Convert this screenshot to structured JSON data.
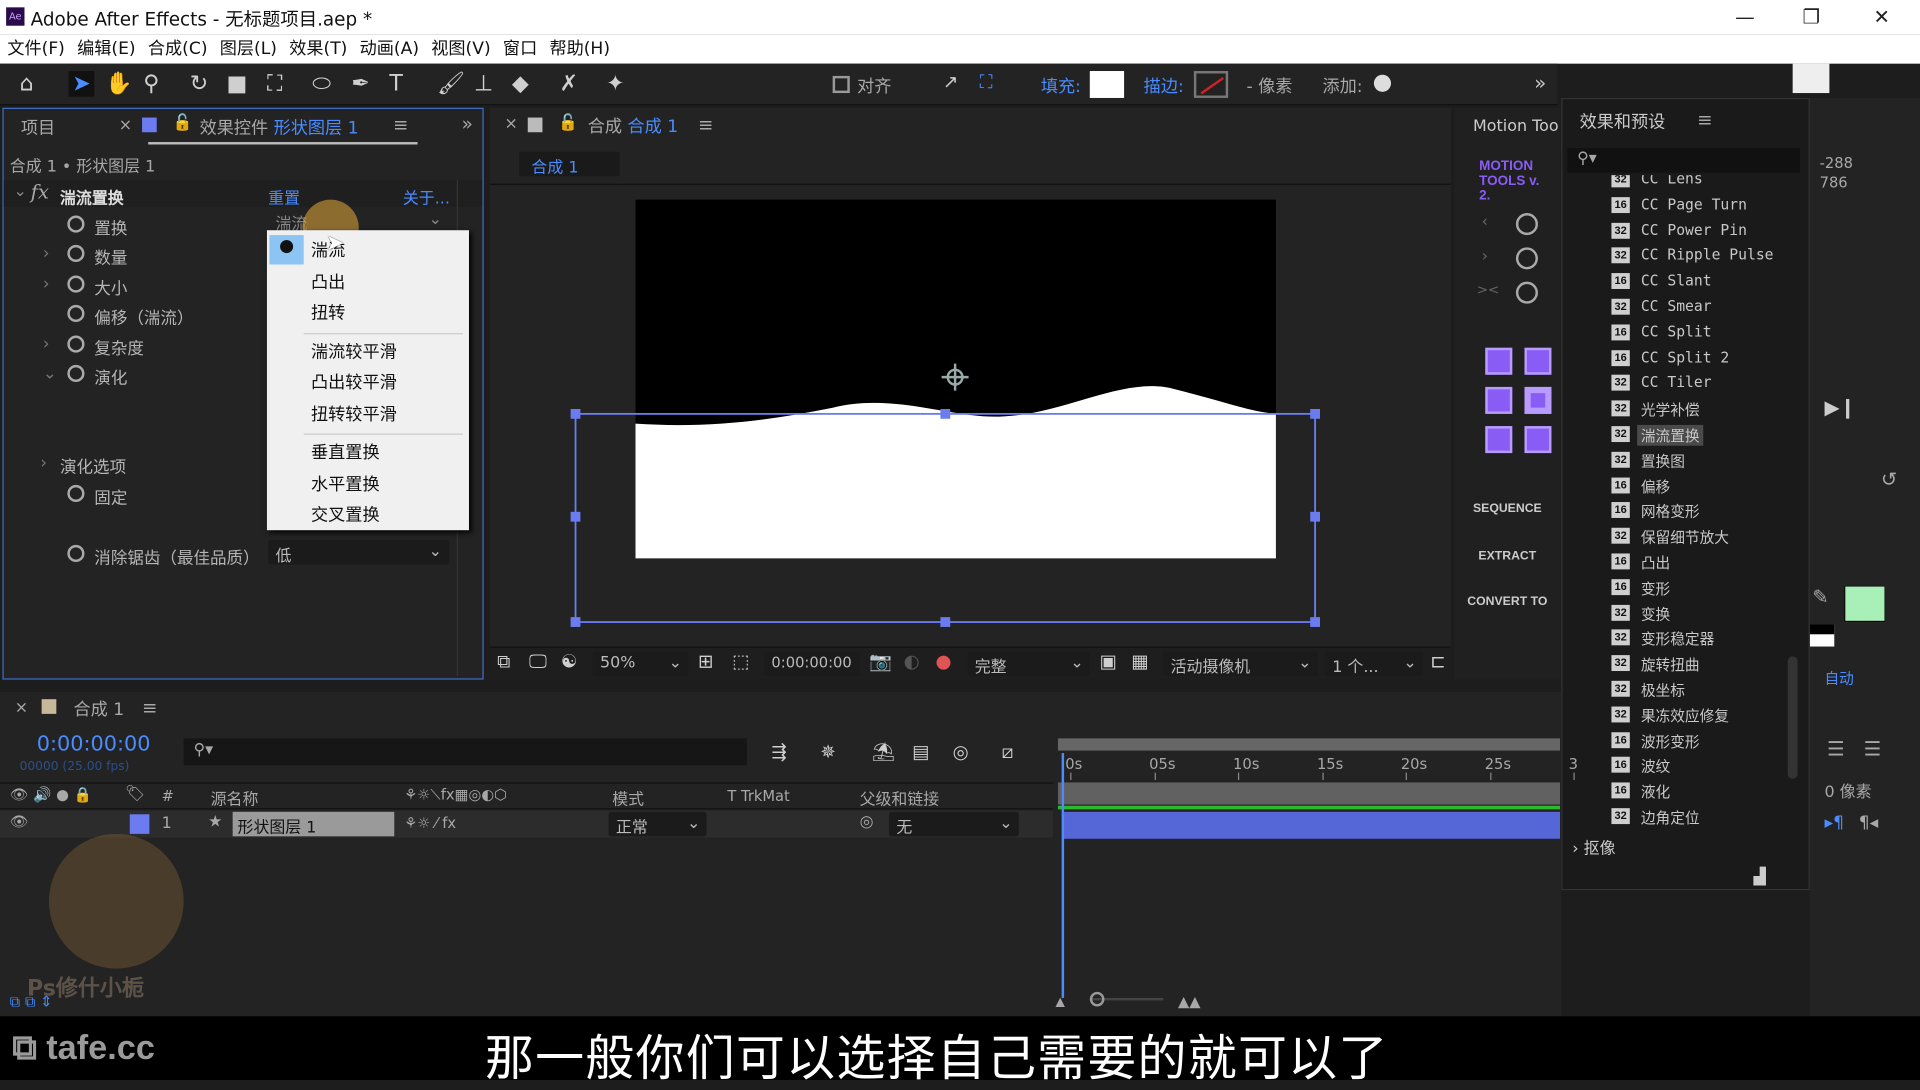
{
  "window": {
    "app_icon": "Ae",
    "title": "Adobe After Effects - 无标题项目.aep *"
  },
  "menu": [
    "文件(F)",
    "编辑(E)",
    "合成(C)",
    "图层(L)",
    "效果(T)",
    "动画(A)",
    "视图(V)",
    "窗口",
    "帮助(H)"
  ],
  "toolbar": {
    "align": "对齐",
    "fill": "填充:",
    "stroke": "描边:",
    "pixels": "- 像素",
    "add": "添加:",
    "fill_color": "#ffffff",
    "overflow": "»"
  },
  "left_panel": {
    "tab_project": "项目",
    "tab_effects": "效果控件",
    "tab_effects_layer": "形状图层 1",
    "breadcrumb": "合成 1 • 形状图层 1",
    "effect_name": "湍流置换",
    "reset": "重置",
    "about": "关于...",
    "props": [
      {
        "label": "置换",
        "value": "湍流"
      },
      {
        "label": "数量"
      },
      {
        "label": "大小"
      },
      {
        "label": "偏移（湍流）"
      },
      {
        "label": "复杂度"
      },
      {
        "label": "演化"
      },
      {
        "label": "演化选项"
      },
      {
        "label": "固定"
      },
      {
        "label": "消除锯齿（最佳品质）",
        "value": "低"
      }
    ]
  },
  "dropdown": {
    "groups": [
      [
        "湍流",
        "凸出",
        "扭转"
      ],
      [
        "湍流较平滑",
        "凸出较平滑",
        "扭转较平滑"
      ],
      [
        "垂直置换",
        "水平置换",
        "交叉置换"
      ]
    ],
    "selected": "湍流"
  },
  "comp_panel": {
    "tab_prefix": "合成",
    "tab_name": "合成 1",
    "sub_tab": "合成 1",
    "zoom": "50%",
    "timecode": "0:00:00:00",
    "quality": "完整",
    "camera": "活动摄像机",
    "views": "1 个..."
  },
  "motion_tools": {
    "title": "Motion Too",
    "logo": "MOTION TOOLS v. 2.",
    "sequence": "SEQUENCE",
    "extract": "EXTRACT",
    "convert": "CONVERT TO",
    "accent": "#8a5cf6"
  },
  "effects_panel": {
    "title": "效果和预设",
    "items": [
      {
        "b": "32",
        "n": "CC Lens"
      },
      {
        "b": "16",
        "n": "CC Page Turn"
      },
      {
        "b": "32",
        "n": "CC Power Pin"
      },
      {
        "b": "32",
        "n": "CC Ripple Pulse"
      },
      {
        "b": "16",
        "n": "CC Slant"
      },
      {
        "b": "32",
        "n": "CC Smear"
      },
      {
        "b": "16",
        "n": "CC Split"
      },
      {
        "b": "16",
        "n": "CC Split 2"
      },
      {
        "b": "32",
        "n": "CC Tiler"
      },
      {
        "b": "32",
        "n": "光学补偿"
      },
      {
        "b": "32",
        "n": "湍流置换",
        "sel": true
      },
      {
        "b": "32",
        "n": "置换图"
      },
      {
        "b": "16",
        "n": "偏移"
      },
      {
        "b": "16",
        "n": "网格变形"
      },
      {
        "b": "32",
        "n": "保留细节放大"
      },
      {
        "b": "16",
        "n": "凸出"
      },
      {
        "b": "16",
        "n": "变形"
      },
      {
        "b": "32",
        "n": "变换"
      },
      {
        "b": "32",
        "n": "变形稳定器"
      },
      {
        "b": "32",
        "n": "旋转扭曲"
      },
      {
        "b": "32",
        "n": "极坐标"
      },
      {
        "b": "32",
        "n": "果冻效应修复"
      },
      {
        "b": "16",
        "n": "波形变形"
      },
      {
        "b": "16",
        "n": "波纹"
      },
      {
        "b": "16",
        "n": "液化"
      },
      {
        "b": "32",
        "n": "边角定位"
      }
    ],
    "next_group": "抠像"
  },
  "far_right": {
    "x": "-288",
    "y": "786",
    "auto": "自动",
    "pixels": "0 像素",
    "fill_color": "#a8f0b8"
  },
  "timeline": {
    "tab": "合成 1",
    "timecode": "0:00:00:00",
    "fps": "00000 (25.00 fps)",
    "headers": {
      "num": "#",
      "source": "源名称",
      "mode": "模式",
      "trkmat": "TrkMat",
      "parent": "父级和链接"
    },
    "layer": {
      "num": "1",
      "name": "形状图层 1",
      "mode": "正常",
      "parent": "无",
      "color": "#6b7cf0"
    },
    "ruler": [
      "0s",
      "05s",
      "10s",
      "15s",
      "20s",
      "25s",
      "3"
    ]
  },
  "subtitle": "那一般你们可以选择自己需要的就可以了",
  "watermark": {
    "logo": "tafe.cc",
    "channel": "Ps修什小栀"
  }
}
